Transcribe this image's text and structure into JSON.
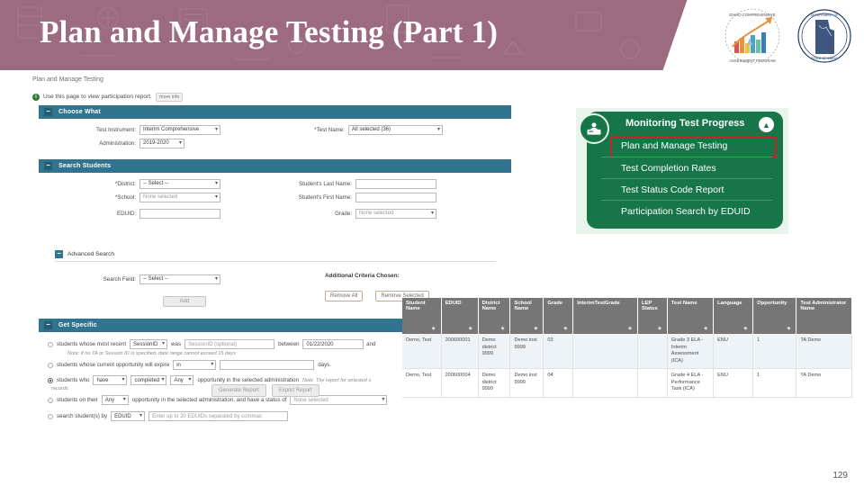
{
  "slide": {
    "title": "Plan and Manage Testing (Part 1)",
    "page_number": "129",
    "header_color": "#9d6b80",
    "teal_color": "#31748f",
    "green_color": "#17754a",
    "highlight_color": "#cc2222"
  },
  "logos": [
    {
      "name": "idaho-comprehensive-assessment-program-logo",
      "text_top": "IDAHO COMPREHENSIVE",
      "text_bottom": "ASSESSMENT PROGRAM"
    },
    {
      "name": "idaho-department-of-education-seal",
      "text_top": "DEPARTMENT OF EDUCATION",
      "text_bottom": "STATE OF IDAHO"
    }
  ],
  "app": {
    "breadcrumb": "Plan and Manage Testing",
    "info_text": "Use this page to view participation report.",
    "more_info_label": "more info",
    "choose_what": {
      "title": "Choose What",
      "fields": [
        {
          "label": "Test Instrument:",
          "value": "Interim Comprehensive",
          "type": "select"
        },
        {
          "label": "Administration:",
          "value": "2019-2020",
          "type": "select"
        },
        {
          "label": "*Test Name:",
          "value": "All selected (36)",
          "type": "select"
        }
      ]
    },
    "search_students": {
      "title": "Search Students",
      "fields": [
        {
          "label": "*District:",
          "value": "-- Select --",
          "type": "select"
        },
        {
          "label": "*School:",
          "value": "None selected",
          "type": "select"
        },
        {
          "label": "EDUID:",
          "value": "",
          "type": "text"
        },
        {
          "label": "Student's Last Name:",
          "value": "",
          "type": "text"
        },
        {
          "label": "Student's First Name:",
          "value": "",
          "type": "text"
        },
        {
          "label": "Grade:",
          "value": "None selected",
          "type": "select"
        }
      ]
    },
    "advanced_search": {
      "title": "Advanced Search",
      "search_field_label": "Search Field:",
      "search_field_value": "-- Select --",
      "add_button": "Add",
      "criteria_title": "Additional Criteria Chosen:",
      "remove_all_button": "Remove All",
      "remove_selected_button": "Remove Selected"
    },
    "get_specific": {
      "title": "Get Specific",
      "row1": {
        "text_a": "students whose most recent",
        "select_a": "SessionID",
        "text_b": "was",
        "input_placeholder": "SessionID (optional)",
        "text_c": "between",
        "date_value": "01/22/2020",
        "text_d": "and",
        "note": "Note: if no TA or Session ID is specified, date range cannot exceed 15 days"
      },
      "row2": {
        "text_a": "students whose current opportunity will expire",
        "select_a": "in",
        "input_value": "",
        "text_b": "days."
      },
      "row3": {
        "text_a": "students who",
        "select_a": "have",
        "select_b": "completed",
        "select_c": "Any",
        "text_b": "opportunity in the selected administration",
        "note": "Note: The report for untested s",
        "note2": "records"
      },
      "row4": {
        "text_a": "students on their",
        "select_a": "Any",
        "text_b": "opportunity in the selected administration, and have a status of",
        "select_b": "None selected"
      },
      "row5": {
        "text_a": "search student(s) by",
        "select_a": "EDUID",
        "input_placeholder": "Enter up to 20 EDUIDs separated by commas"
      }
    },
    "buttons": {
      "generate_report": "Generate Report",
      "export_report": "Export Report"
    }
  },
  "green_menu": {
    "title": "Monitoring Test Progress",
    "icon": "test-progress-icon",
    "chevron": "▲",
    "items": [
      {
        "label": "Plan and Manage Testing",
        "highlighted": true
      },
      {
        "label": "Test Completion Rates",
        "highlighted": false
      },
      {
        "label": "Test Status Code Report",
        "highlighted": false
      },
      {
        "label": "Participation Search by EDUID",
        "highlighted": false
      }
    ]
  },
  "data_table": {
    "columns": [
      "Student Name",
      "EDUID",
      "District Name",
      "School Name",
      "Grade",
      "InterimTestGrade",
      "LEP Status",
      "Test Name",
      "Language",
      "Opportunity",
      "Test Administrator Name"
    ],
    "rows": [
      {
        "student_name": "Demo, Test",
        "eduid": "200600001",
        "district_name": "Demo district 9999",
        "school_name": "Demo inst 9999",
        "grade": "03",
        "interim_test_grade": "",
        "lep_status": "",
        "test_name": "Grade 3 ELA - Interim Assessment (ICA)",
        "language": "ENU",
        "opportunity": "1",
        "test_administrator_name": "TA  Demo"
      },
      {
        "student_name": "Demo, Test",
        "eduid": "200600004",
        "district_name": "Demo district 9999",
        "school_name": "Demo inst 9999",
        "grade": "04",
        "interim_test_grade": "",
        "lep_status": "",
        "test_name": "Grade 4 ELA - Performance Task (ICA)",
        "language": "ENU",
        "opportunity": "1",
        "test_administrator_name": "TA  Demo"
      }
    ]
  }
}
